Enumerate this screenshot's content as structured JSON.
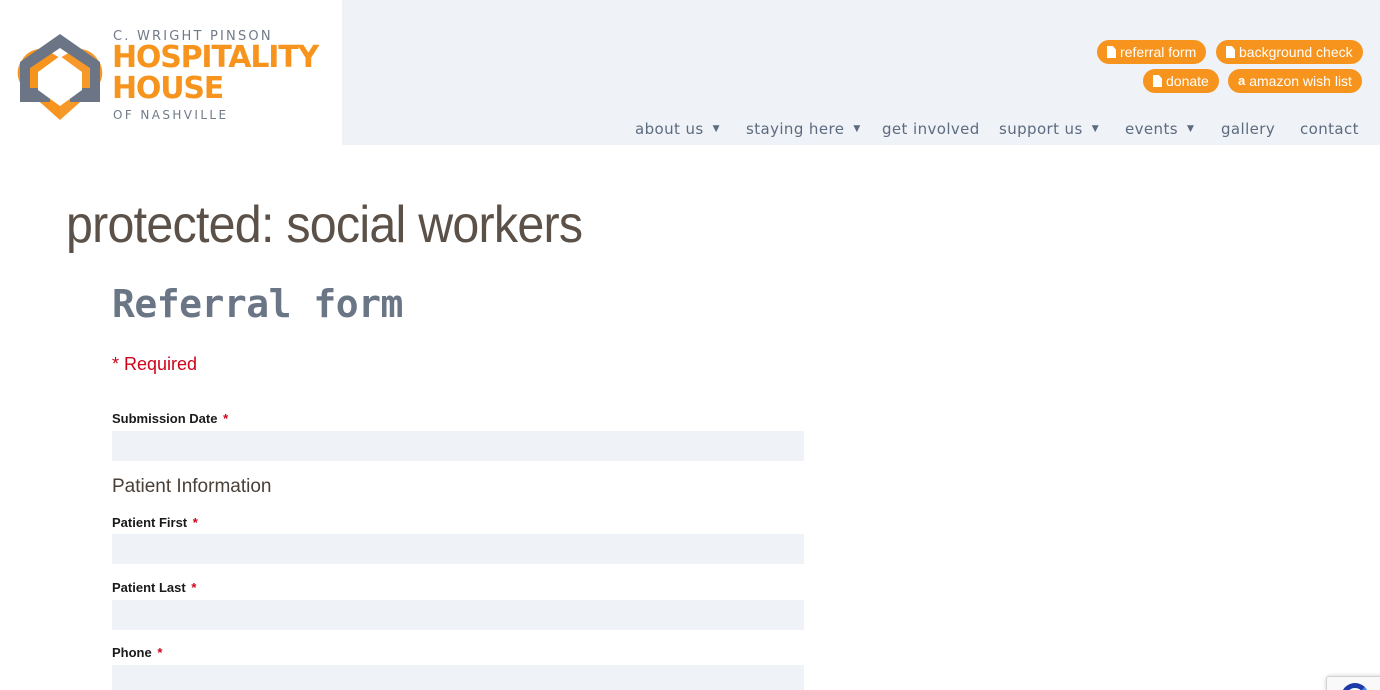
{
  "logo": {
    "line_top": "C. WRIGHT PINSON",
    "line_1": "HOSPITALITY",
    "line_2": "HOUSE",
    "line_bottom": "OF NASHVILLE",
    "colors": {
      "orange": "#f7941d",
      "gray": "#707a88"
    }
  },
  "quick_links": [
    {
      "label": "referral form",
      "icon": "document-icon"
    },
    {
      "label": "background check",
      "icon": "document-icon"
    },
    {
      "label": "donate",
      "icon": "document-icon"
    },
    {
      "label": "amazon wish list",
      "icon": "amazon-icon"
    }
  ],
  "nav": [
    {
      "label": "about us",
      "has_dropdown": true
    },
    {
      "label": "staying here",
      "has_dropdown": true
    },
    {
      "label": "get involved",
      "has_dropdown": false
    },
    {
      "label": "support us",
      "has_dropdown": true
    },
    {
      "label": "events",
      "has_dropdown": true
    },
    {
      "label": "gallery",
      "has_dropdown": false
    },
    {
      "label": "contact",
      "has_dropdown": false
    }
  ],
  "page": {
    "title": "protected: social workers",
    "form_title": "Referral form",
    "required_note": "* Required",
    "fields": [
      {
        "label": "Submission Date",
        "required_mark": "*",
        "value": ""
      },
      {
        "label": "Patient First",
        "required_mark": "*",
        "value": ""
      },
      {
        "label": "Patient Last",
        "required_mark": "*",
        "value": ""
      },
      {
        "label": "Phone",
        "required_mark": "*",
        "value": ""
      }
    ],
    "section_heading": "Patient Information"
  },
  "colors": {
    "accent": "#f7941d",
    "header_bg": "#eff2f6",
    "required": "#d0021b",
    "nav_text": "#5d6b80"
  }
}
